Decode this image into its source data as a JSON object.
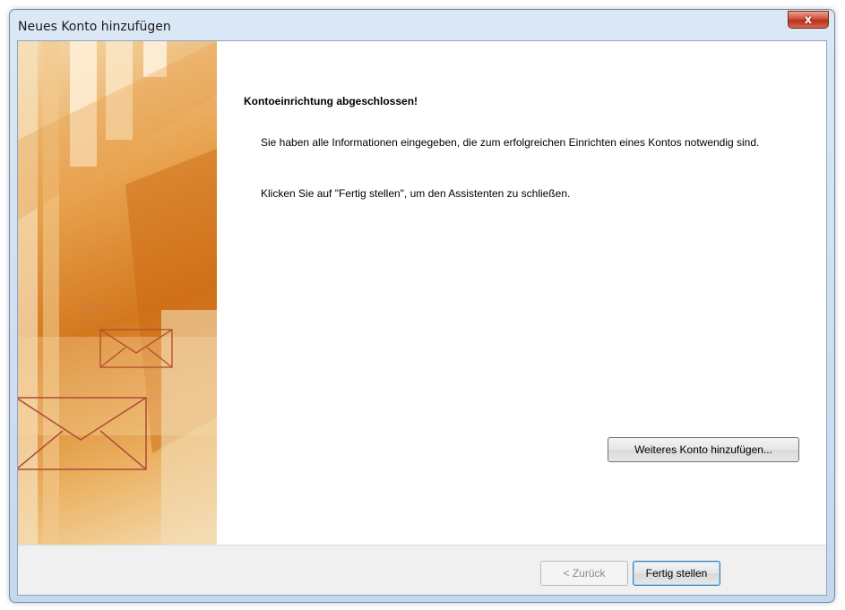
{
  "window": {
    "title": "Neues Konto hinzufügen",
    "close_label": "x"
  },
  "content": {
    "heading": "Kontoeinrichtung abgeschlossen!",
    "paragraph_1": "Sie haben alle Informationen eingegeben, die zum erfolgreichen Einrichten eines Kontos notwendig sind.",
    "paragraph_2": "Klicken Sie auf \"Fertig stellen\", um den Assistenten zu schließen.",
    "add_account_button": "Weiteres Konto hinzufügen..."
  },
  "footer": {
    "back_button": "< Zurück",
    "back_enabled": false,
    "finish_button": "Fertig stellen"
  },
  "colors": {
    "banner_orange": "#d4781e",
    "title_bar": "#c4d8ee",
    "close_red": "#c9442e",
    "default_button_border": "#3c7fb1"
  }
}
